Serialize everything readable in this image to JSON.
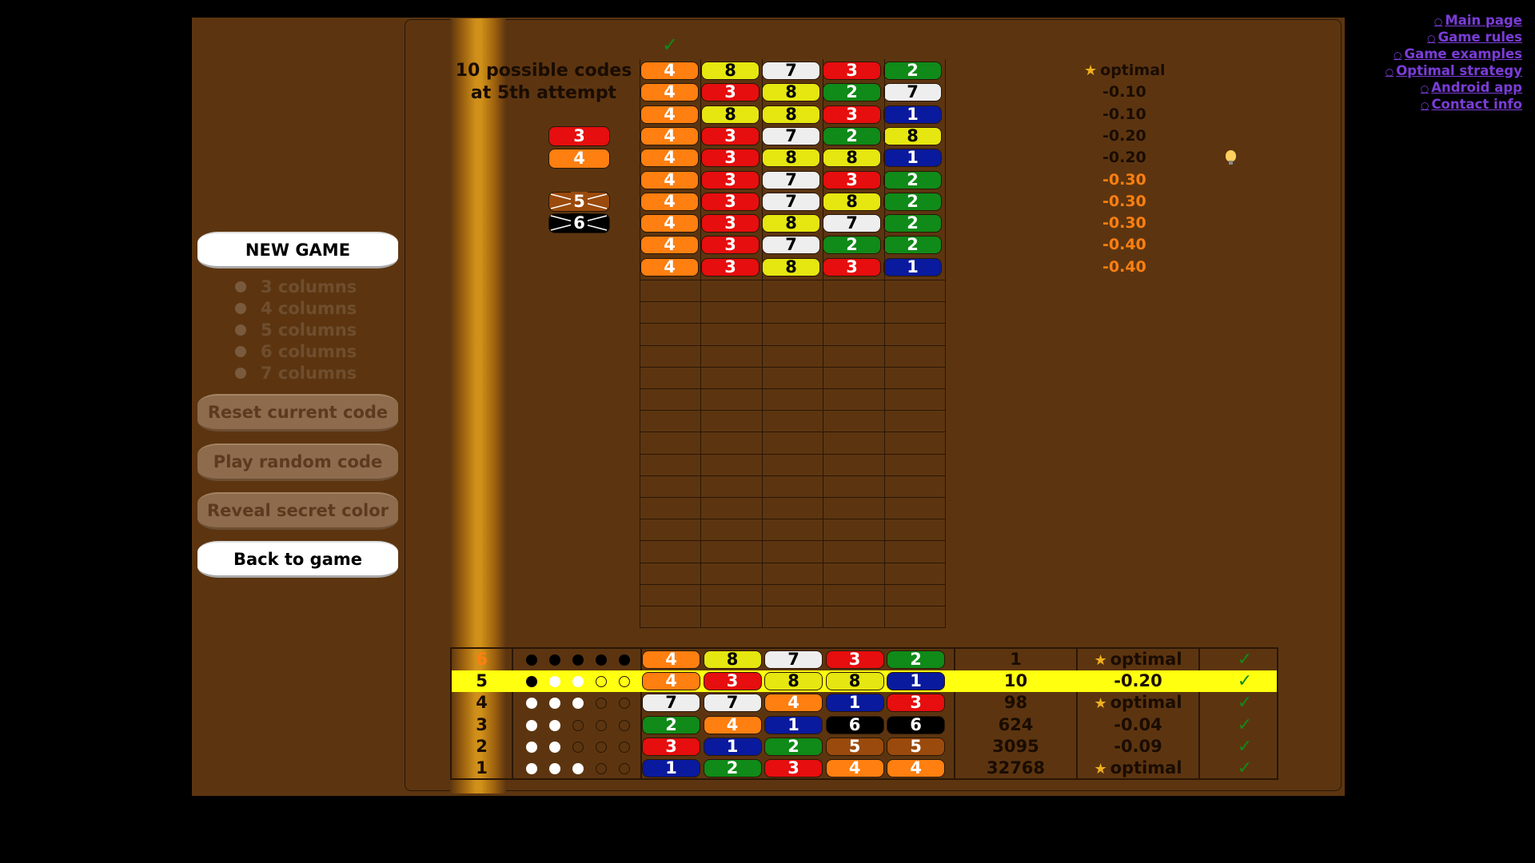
{
  "nav_links": [
    {
      "label": "Main page"
    },
    {
      "label": "Game rules"
    },
    {
      "label": "Game examples"
    },
    {
      "label": "Optimal strategy"
    },
    {
      "label": "Android app"
    },
    {
      "label": "Contact info"
    }
  ],
  "left_panel": {
    "new_game": "NEW GAME",
    "column_options": [
      "3 columns",
      "4 columns",
      "5 columns",
      "6 columns",
      "7 columns"
    ],
    "reset_current_code": "Reset current code",
    "play_random_code": "Play random code",
    "reveal_secret_color": "Reveal secret color",
    "back_to_game": "Back to game"
  },
  "status": {
    "line1": "10 possible codes",
    "line2": "at 5th attempt"
  },
  "colors": {
    "1": "#0a1a9e",
    "2": "#108a18",
    "3": "#e60e0e",
    "4": "#ff7f10",
    "5": "#9a4a0c",
    "6": "#000000",
    "7": "#eeeeee",
    "8": "#e6e610"
  },
  "side_pegs": [
    {
      "value": "3",
      "color": 3,
      "state": "normal"
    },
    {
      "value": "4",
      "color": 4,
      "state": "normal"
    },
    {
      "value": "5",
      "color": 5,
      "state": "crossed"
    },
    {
      "value": "6",
      "color": 6,
      "state": "crossed"
    }
  ],
  "possible_codes": [
    {
      "code": [
        4,
        8,
        7,
        3,
        2
      ],
      "score": "optimal",
      "star": true,
      "score_color": "dark"
    },
    {
      "code": [
        4,
        3,
        8,
        2,
        7
      ],
      "score": "-0.10",
      "star": false,
      "score_color": "dark"
    },
    {
      "code": [
        4,
        8,
        8,
        3,
        1
      ],
      "score": "-0.10",
      "star": false,
      "score_color": "dark"
    },
    {
      "code": [
        4,
        3,
        7,
        2,
        8
      ],
      "score": "-0.20",
      "star": false,
      "score_color": "dark"
    },
    {
      "code": [
        4,
        3,
        8,
        8,
        1
      ],
      "score": "-0.20",
      "star": false,
      "score_color": "dark"
    },
    {
      "code": [
        4,
        3,
        7,
        3,
        2
      ],
      "score": "-0.30",
      "star": false,
      "score_color": "orange"
    },
    {
      "code": [
        4,
        3,
        7,
        8,
        2
      ],
      "score": "-0.30",
      "star": false,
      "score_color": "orange"
    },
    {
      "code": [
        4,
        3,
        8,
        7,
        2
      ],
      "score": "-0.30",
      "star": false,
      "score_color": "orange"
    },
    {
      "code": [
        4,
        3,
        7,
        2,
        2
      ],
      "score": "-0.40",
      "star": false,
      "score_color": "orange"
    },
    {
      "code": [
        4,
        3,
        8,
        3,
        1
      ],
      "score": "-0.40",
      "star": false,
      "score_color": "orange"
    }
  ],
  "history": [
    {
      "attempt": "6",
      "feedback": [
        "b",
        "b",
        "b",
        "b",
        "b"
      ],
      "code": [
        4,
        8,
        7,
        3,
        2
      ],
      "count": "1",
      "score": "optimal",
      "star": true,
      "highlight": false,
      "attempt_color": "orange"
    },
    {
      "attempt": "5",
      "feedback": [
        "b",
        "w",
        "w",
        "e",
        "e"
      ],
      "code": [
        4,
        3,
        8,
        8,
        1
      ],
      "count": "10",
      "score": "-0.20",
      "star": false,
      "highlight": true,
      "attempt_color": "dark"
    },
    {
      "attempt": "4",
      "feedback": [
        "w",
        "w",
        "w",
        "e",
        "e"
      ],
      "code": [
        7,
        7,
        4,
        1,
        3
      ],
      "count": "98",
      "score": "optimal",
      "star": true,
      "highlight": false,
      "attempt_color": "dark"
    },
    {
      "attempt": "3",
      "feedback": [
        "w",
        "w",
        "e",
        "e",
        "e"
      ],
      "code": [
        2,
        4,
        1,
        6,
        6
      ],
      "count": "624",
      "score": "-0.04",
      "star": false,
      "highlight": false,
      "attempt_color": "dark"
    },
    {
      "attempt": "2",
      "feedback": [
        "w",
        "w",
        "e",
        "e",
        "e"
      ],
      "code": [
        3,
        1,
        2,
        5,
        5
      ],
      "count": "3095",
      "score": "-0.09",
      "star": false,
      "highlight": false,
      "attempt_color": "dark"
    },
    {
      "attempt": "1",
      "feedback": [
        "w",
        "w",
        "w",
        "e",
        "e"
      ],
      "code": [
        1,
        2,
        3,
        4,
        4
      ],
      "count": "32768",
      "score": "optimal",
      "star": true,
      "highlight": false,
      "attempt_color": "dark"
    }
  ],
  "icons": {
    "check": "checkmark-icon",
    "star": "star-icon",
    "bulb": "lightbulb-icon"
  }
}
